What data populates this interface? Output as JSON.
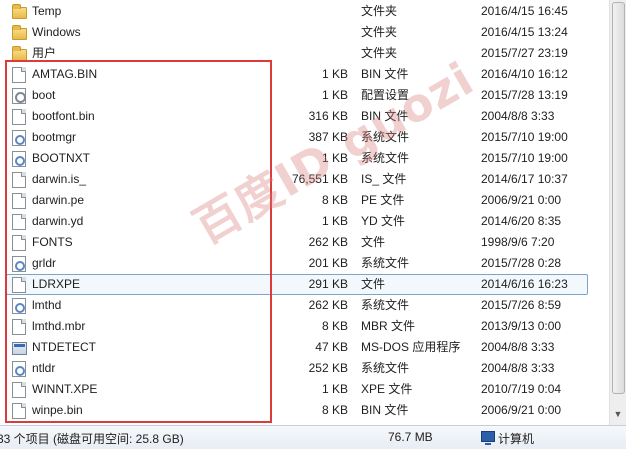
{
  "folders": [
    {
      "name": "Temp",
      "type": "文件夹",
      "date": "2016/4/15 16:45",
      "icon": "folder-icon"
    },
    {
      "name": "Windows",
      "type": "文件夹",
      "date": "2016/4/15 13:24",
      "icon": "folder-icon"
    },
    {
      "name": "用户",
      "type": "文件夹",
      "date": "2015/7/27 23:19",
      "icon": "folder-icon"
    }
  ],
  "files": [
    {
      "name": "AMTAG.BIN",
      "size": "1 KB",
      "type": "BIN 文件",
      "date": "2016/4/10 16:12",
      "icon": "doc"
    },
    {
      "name": "boot",
      "size": "1 KB",
      "type": "配置设置",
      "date": "2015/7/28 13:19",
      "icon": "cfg"
    },
    {
      "name": "bootfont.bin",
      "size": "316 KB",
      "type": "BIN 文件",
      "date": "2004/8/8 3:33",
      "icon": "doc"
    },
    {
      "name": "bootmgr",
      "size": "387 KB",
      "type": "系统文件",
      "date": "2015/7/10 19:00",
      "icon": "sys"
    },
    {
      "name": "BOOTNXT",
      "size": "1 KB",
      "type": "系统文件",
      "date": "2015/7/10 19:00",
      "icon": "sys"
    },
    {
      "name": "darwin.is_",
      "size": "76,551 KB",
      "type": "IS_ 文件",
      "date": "2014/6/17 10:37",
      "icon": "doc"
    },
    {
      "name": "darwin.pe",
      "size": "8 KB",
      "type": "PE 文件",
      "date": "2006/9/21 0:00",
      "icon": "doc"
    },
    {
      "name": "darwin.yd",
      "size": "1 KB",
      "type": "YD 文件",
      "date": "2014/6/20 8:35",
      "icon": "doc"
    },
    {
      "name": "FONTS",
      "size": "262 KB",
      "type": "文件",
      "date": "1998/9/6 7:20",
      "icon": "doc"
    },
    {
      "name": "grldr",
      "size": "201 KB",
      "type": "系统文件",
      "date": "2015/7/28 0:28",
      "icon": "sys"
    },
    {
      "name": "LDRXPE",
      "size": "291 KB",
      "type": "文件",
      "date": "2014/6/16 16:23",
      "icon": "doc",
      "selected": true
    },
    {
      "name": "lmthd",
      "size": "262 KB",
      "type": "系统文件",
      "date": "2015/7/26 8:59",
      "icon": "sys"
    },
    {
      "name": "lmthd.mbr",
      "size": "8 KB",
      "type": "MBR 文件",
      "date": "2013/9/13 0:00",
      "icon": "doc"
    },
    {
      "name": "NTDETECT",
      "size": "47 KB",
      "type": "MS-DOS 应用程序",
      "date": "2004/8/8 3:33",
      "icon": "app"
    },
    {
      "name": "ntldr",
      "size": "252 KB",
      "type": "系统文件",
      "date": "2004/8/8 3:33",
      "icon": "sys"
    },
    {
      "name": "WINNT.XPE",
      "size": "1 KB",
      "type": "XPE 文件",
      "date": "2010/7/19 0:04",
      "icon": "doc"
    },
    {
      "name": "winpe.bin",
      "size": "8 KB",
      "type": "BIN 文件",
      "date": "2006/9/21 0:00",
      "icon": "doc"
    }
  ],
  "watermark": "百度ID guozi",
  "status": {
    "items": "33 个项目 (磁盘可用空间: 25.8 GB)",
    "size": "76.7 MB",
    "location": "计算机"
  },
  "colors": {
    "highlight_border": "#dc3b3b",
    "selection_border": "#7da2ce"
  }
}
